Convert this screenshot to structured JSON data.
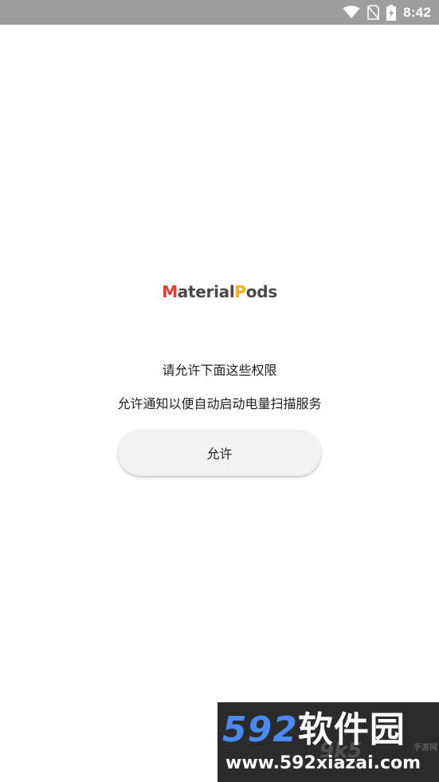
{
  "status_bar": {
    "time": "8:42",
    "icons": [
      "wifi-icon",
      "no-sim-icon",
      "battery-charging-icon"
    ],
    "background": "#9e9e9e"
  },
  "logo": {
    "first_letter": "M",
    "part1": "aterial",
    "second_letter": "P",
    "part2": "ods",
    "colors": {
      "m": "#e53935",
      "p": "#f9b000",
      "text": "#494949"
    }
  },
  "permission": {
    "title": "请允许下面这些权限",
    "description": "允许通知以便自动启动电量扫描服务",
    "allow_label": "允许"
  },
  "watermark": {
    "brand_number": "592",
    "brand_text": "软件园",
    "url": "www.592xiazai.com",
    "ghost": "9k5",
    "side_text": "手游网"
  }
}
